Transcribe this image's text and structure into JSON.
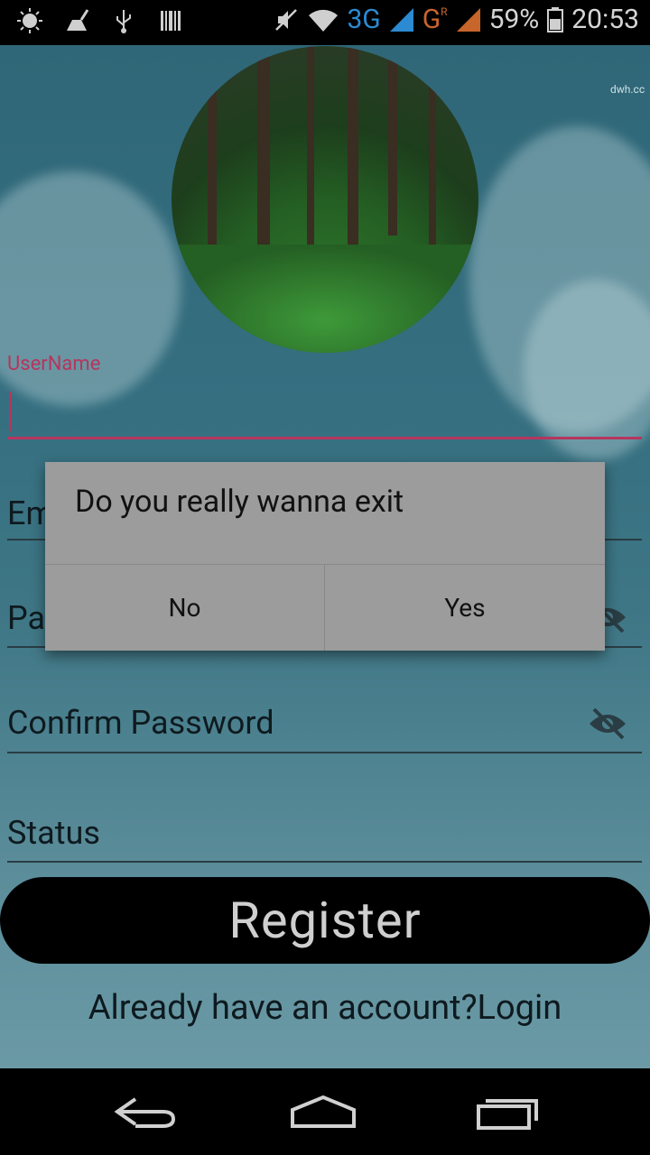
{
  "status_bar": {
    "network_3g": "3G",
    "network_g": "G",
    "roaming_mark": "R",
    "battery": "59%",
    "time": "20:53",
    "left_icons": [
      "brightness-icon",
      "cleaner-icon",
      "usb-icon",
      "barcode-icon"
    ],
    "right_icons": [
      "mute-icon",
      "wifi-icon",
      "signal-icon",
      "signal-icon",
      "battery-icon"
    ]
  },
  "form": {
    "username_label": "UserName",
    "email_partial": "Em",
    "password_partial": "Pa",
    "confirm_password": "Confirm Password",
    "status": "Status",
    "register_label": "Register",
    "login_link": "Already have an account?Login"
  },
  "dialog": {
    "message": "Do you really wanna exit",
    "no_label": "No",
    "yes_label": "Yes"
  },
  "watermark": "dwh.cc",
  "colors": {
    "accent": "#b5365e",
    "background_top": "#2f6778",
    "background_bottom": "#6b9aa6",
    "dialog_bg": "#9c9c9c",
    "button_bg": "#000000"
  }
}
